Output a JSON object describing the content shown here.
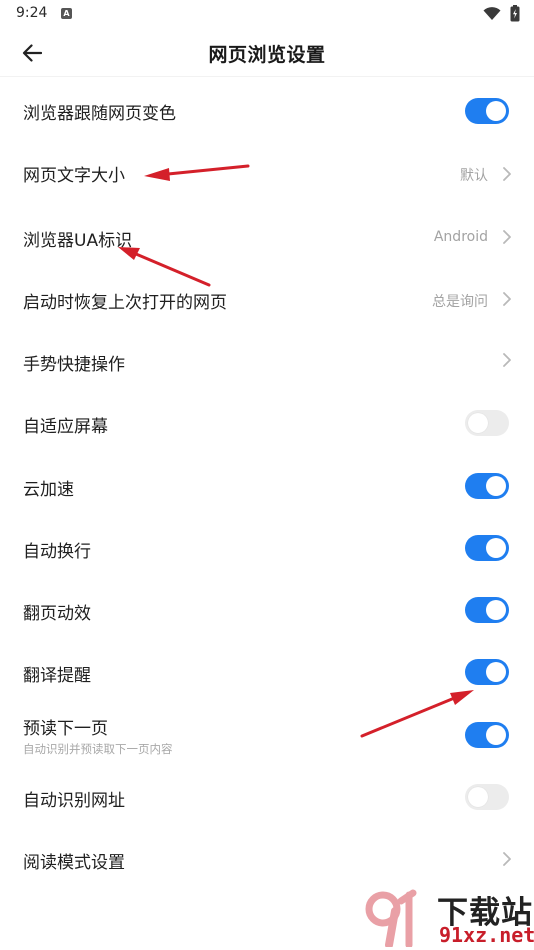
{
  "status_bar": {
    "time": "9:24",
    "notification_glyph": "A",
    "icons": [
      "wifi-icon",
      "battery-icon"
    ]
  },
  "header": {
    "title": "网页浏览设置",
    "back_icon": "arrow-left-icon"
  },
  "settings": [
    {
      "label": "浏览器跟随网页变色",
      "kind": "toggle",
      "on": true
    },
    {
      "label": "网页文字大小",
      "kind": "nav",
      "value": "默认"
    },
    {
      "label": "浏览器UA标识",
      "kind": "nav",
      "value": "Android"
    },
    {
      "label": "启动时恢复上次打开的网页",
      "kind": "nav",
      "value": "总是询问"
    },
    {
      "label": "手势快捷操作",
      "kind": "nav",
      "value": ""
    },
    {
      "label": "自适应屏幕",
      "kind": "toggle",
      "on": false
    },
    {
      "label": "云加速",
      "kind": "toggle",
      "on": true
    },
    {
      "label": "自动换行",
      "kind": "toggle",
      "on": true
    },
    {
      "label": "翻页动效",
      "kind": "toggle",
      "on": true
    },
    {
      "label": "翻译提醒",
      "kind": "toggle",
      "on": true
    },
    {
      "label": "预读下一页",
      "sublabel": "自动识别并预读取下一页内容",
      "kind": "toggle",
      "on": true
    },
    {
      "label": "自动识别网址",
      "kind": "toggle",
      "on": false
    },
    {
      "label": "阅读模式设置",
      "kind": "nav",
      "value": ""
    }
  ],
  "colors": {
    "toggle_on": "#1f7ef0",
    "toggle_off": "#ececec",
    "annotation_arrow": "#d4202a",
    "watermark_red": "#c81e2a"
  },
  "watermark": {
    "title": "下载站",
    "url": "91xz.net"
  }
}
